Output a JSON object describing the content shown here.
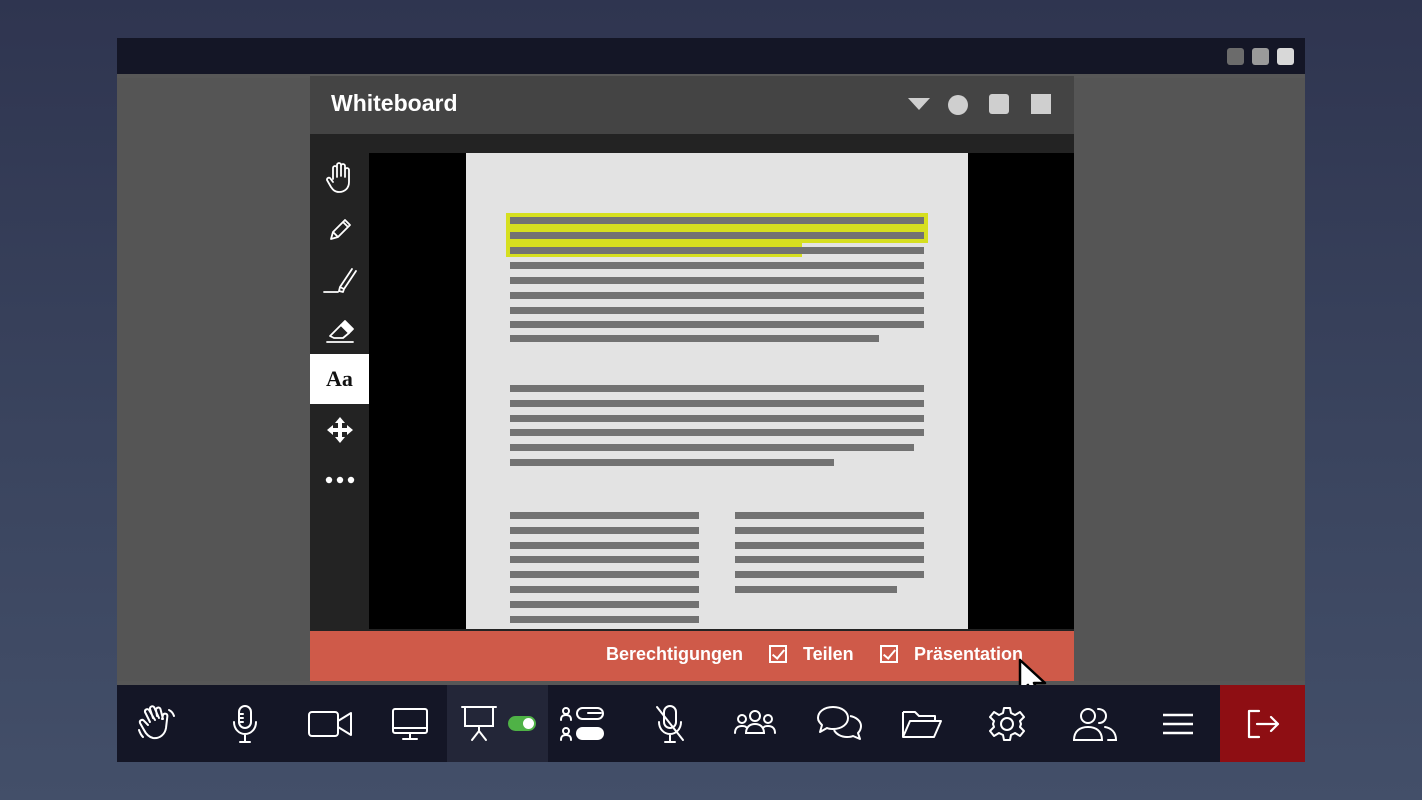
{
  "whiteboard": {
    "title": "Whiteboard",
    "header_controls": [
      "caret-down-icon",
      "circle-icon",
      "square-icon",
      "square-icon"
    ]
  },
  "tools": [
    {
      "icon": "hand-icon",
      "active": false
    },
    {
      "icon": "pencil-icon",
      "active": false
    },
    {
      "icon": "highlighter-icon",
      "active": false
    },
    {
      "icon": "eraser-icon",
      "active": false
    },
    {
      "icon": "text-tool-icon",
      "label": "Aa",
      "active": true
    },
    {
      "icon": "move-icon",
      "active": false
    },
    {
      "icon": "more-icon",
      "active": false
    }
  ],
  "permissions": {
    "label": "Berechtigungen",
    "share": {
      "label": "Teilen",
      "checked": true
    },
    "presentation": {
      "label": "Präsentation",
      "checked": true
    }
  },
  "toolbar": {
    "items": [
      "raise-hand-icon",
      "microphone-icon",
      "camera-icon",
      "screen-share-icon",
      "presentation-icon",
      "layout-icon",
      "mute-all-icon",
      "participants-icon",
      "chat-icon",
      "folder-icon",
      "settings-icon",
      "users-icon",
      "menu-icon",
      "leave-icon"
    ],
    "presentation_toggle_on": true
  },
  "colors": {
    "accent_red": "#cf5a49",
    "leave_red": "#8e0e13",
    "highlight": "#d6df1f",
    "toggle_green": "#4fb246"
  }
}
